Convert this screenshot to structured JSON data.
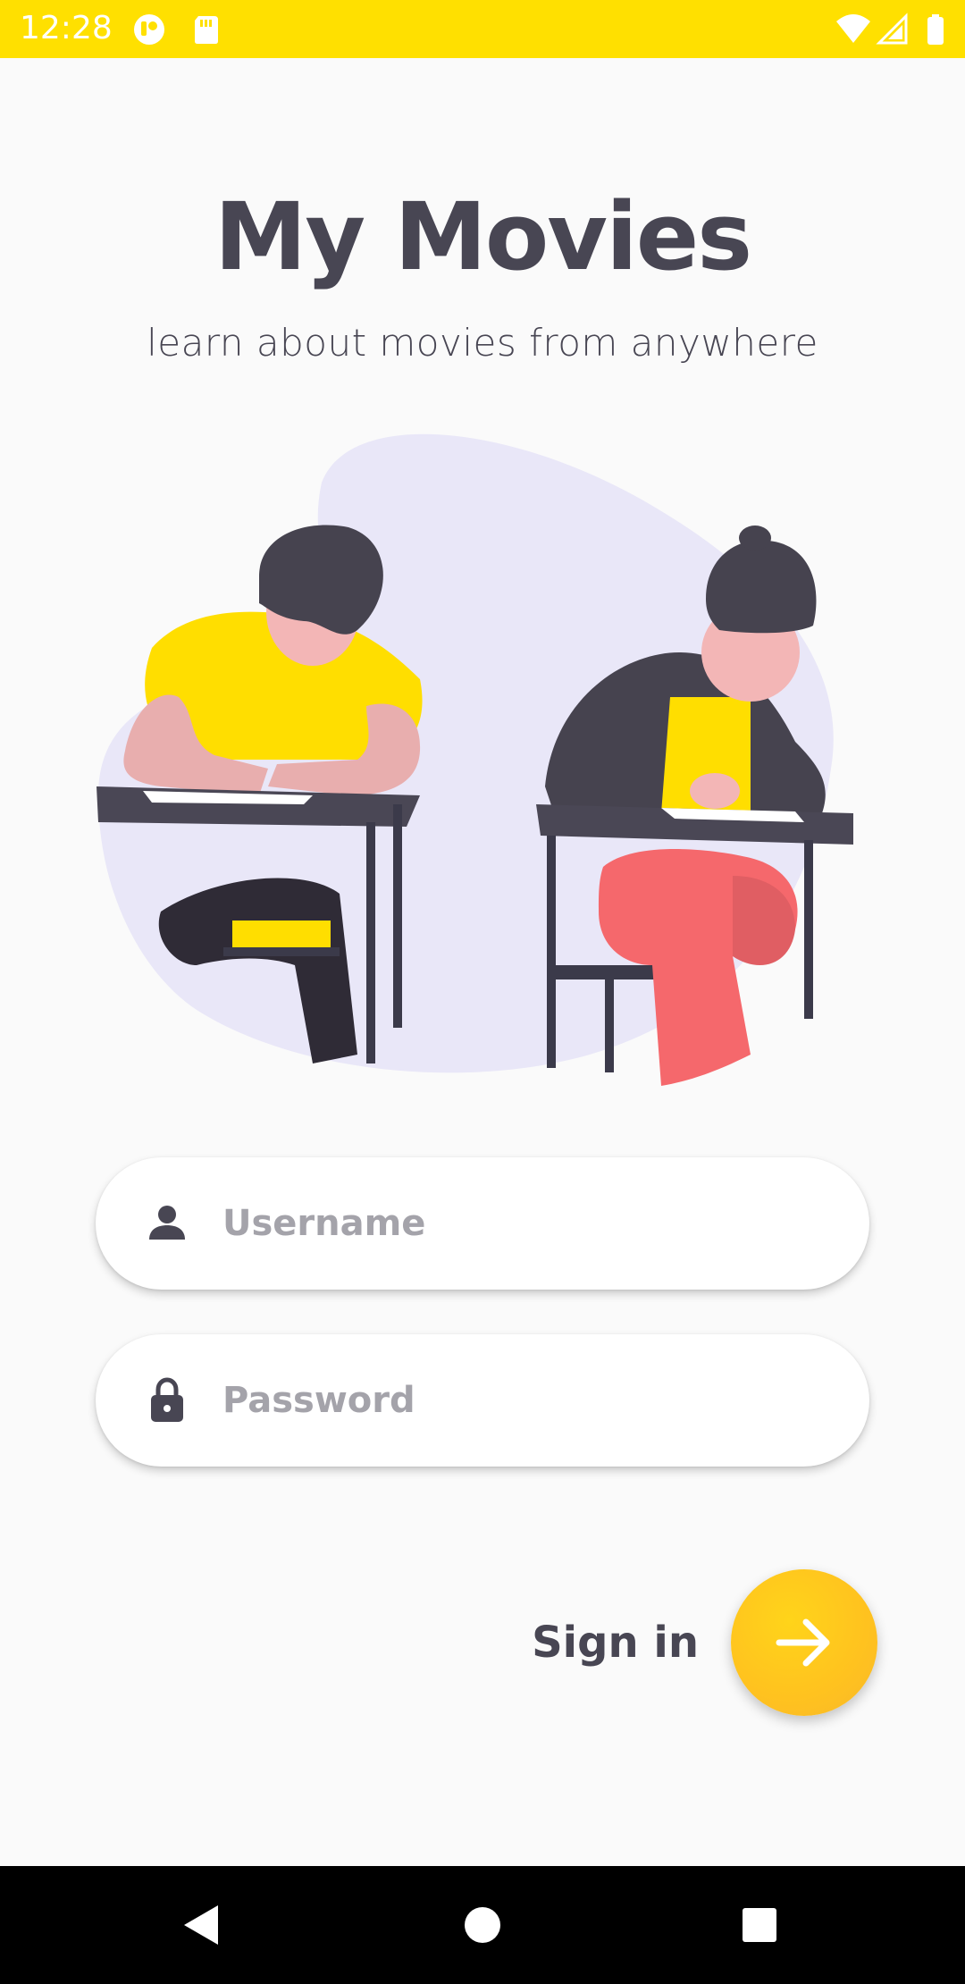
{
  "status_bar": {
    "time": "12:28",
    "background_color": "#ffe000",
    "left_icons": [
      "notification-app-icon",
      "sd-card-icon"
    ],
    "right_icons": [
      "wifi-icon",
      "cell-signal-icon",
      "battery-icon"
    ]
  },
  "header": {
    "title": "My Movies",
    "subtitle": "learn about movies from anywhere"
  },
  "illustration": {
    "icon": "students-writing-illustration"
  },
  "login_form": {
    "username": {
      "icon": "person-icon",
      "placeholder": "Username",
      "value": ""
    },
    "password": {
      "icon": "lock-icon",
      "placeholder": "Password",
      "value": ""
    }
  },
  "sign_in": {
    "label": "Sign in",
    "button_icon": "arrow-right-icon",
    "accent_color": "#ffc21f"
  },
  "nav_bar": {
    "buttons": [
      "back-icon",
      "home-icon",
      "recents-icon"
    ]
  },
  "colors": {
    "primary_text": "#484653",
    "placeholder_text": "#a4a3aa",
    "background": "#fafafa"
  }
}
